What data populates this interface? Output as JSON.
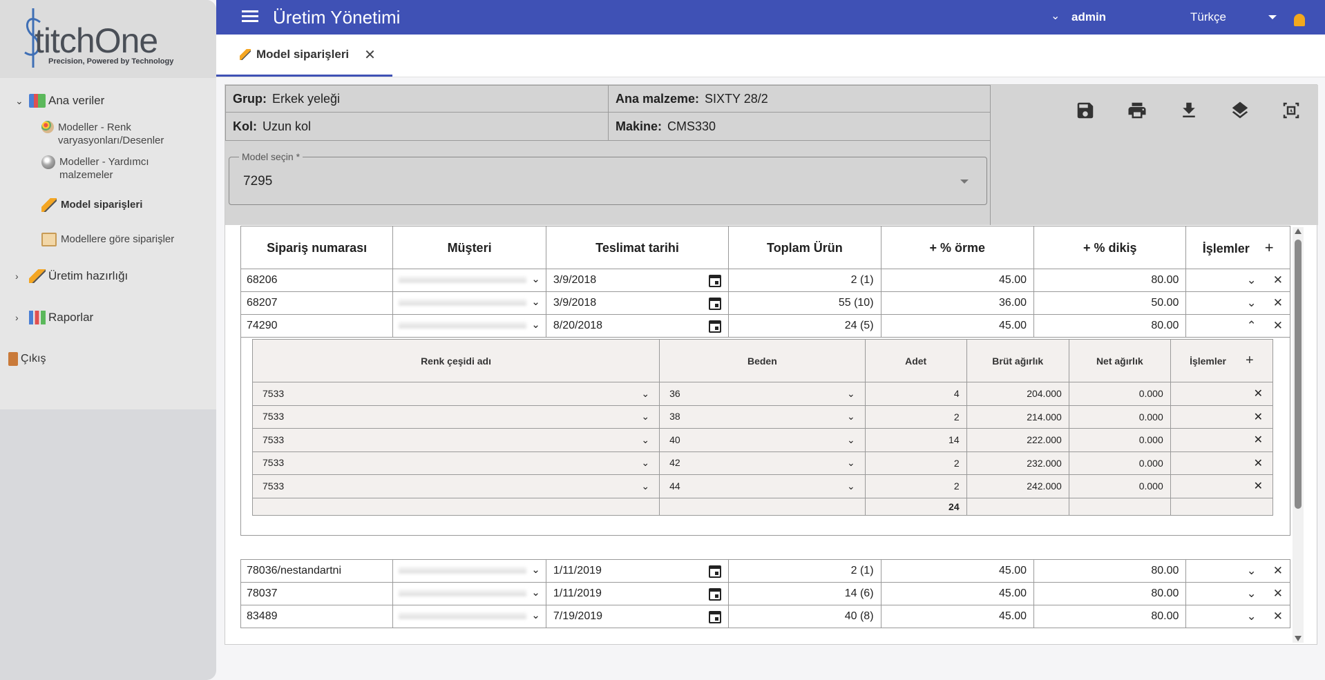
{
  "brand": {
    "logo_first": "S",
    "logo_rest": "titchOne",
    "tagline": "Precision, Powered by Technology"
  },
  "sidebar": {
    "groups": [
      {
        "label": "Ana veriler",
        "expanded": true
      },
      {
        "label": "Üretim hazırlığı",
        "expanded": false
      },
      {
        "label": "Raporlar",
        "expanded": false
      }
    ],
    "subitems": [
      {
        "label": "Modeller - Renk varyasyonları/Desenler"
      },
      {
        "label": "Modeller - Yardımcı malzemeler"
      },
      {
        "label": "Model siparişleri",
        "active": true
      },
      {
        "label": "Modellere göre siparişler"
      }
    ],
    "logout": "Çıkış"
  },
  "topbar": {
    "title": "Üretim Yönetimi",
    "user": "admin",
    "language": "Türkçe"
  },
  "tabs": [
    {
      "label": "Model siparişleri"
    }
  ],
  "header": {
    "group_label": "Grup:",
    "group_value": "Erkek yeleği",
    "material_label": "Ana malzeme:",
    "material_value": "SIXTY 28/2",
    "sleeve_label": "Kol:",
    "sleeve_value": "Uzun kol",
    "machine_label": "Makine:",
    "machine_value": "CMS330",
    "model_select_label": "Model seçin *",
    "model_select_value": "7295"
  },
  "toolbar": {
    "icons": [
      "save-icon",
      "print-icon",
      "download-icon",
      "layers-icon",
      "text-frame-icon"
    ]
  },
  "orders": {
    "columns": [
      "Sipariş numarası",
      "Müşteri",
      "Teslimat tarihi",
      "Toplam Ürün",
      "+ % örme",
      "+ % dikiş",
      "İşlemler"
    ],
    "rows_top": [
      {
        "number": "68206",
        "date": "3/9/2018",
        "total": "2 (1)",
        "knit": "45.00",
        "sew": "80.00",
        "expanded": false
      },
      {
        "number": "68207",
        "date": "3/9/2018",
        "total": "55 (10)",
        "knit": "36.00",
        "sew": "50.00",
        "expanded": false
      },
      {
        "number": "74290",
        "date": "8/20/2018",
        "total": "24 (5)",
        "knit": "45.00",
        "sew": "80.00",
        "expanded": true
      }
    ],
    "rows_bottom": [
      {
        "number": "78036/nestandartni",
        "date": "1/11/2019",
        "total": "2 (1)",
        "knit": "45.00",
        "sew": "80.00"
      },
      {
        "number": "78037",
        "date": "1/11/2019",
        "total": "14 (6)",
        "knit": "45.00",
        "sew": "80.00"
      },
      {
        "number": "83489",
        "date": "7/19/2019",
        "total": "40 (8)",
        "knit": "45.00",
        "sew": "80.00"
      }
    ]
  },
  "details": {
    "columns": [
      "Renk çeşidi adı",
      "Beden",
      "Adet",
      "Brüt ağırlık",
      "Net ağırlık",
      "İşlemler"
    ],
    "rows": [
      {
        "color": "7533",
        "size": "36",
        "qty": "4",
        "gross": "204.000",
        "net": "0.000"
      },
      {
        "color": "7533",
        "size": "38",
        "qty": "2",
        "gross": "214.000",
        "net": "0.000"
      },
      {
        "color": "7533",
        "size": "40",
        "qty": "14",
        "gross": "222.000",
        "net": "0.000"
      },
      {
        "color": "7533",
        "size": "42",
        "qty": "2",
        "gross": "232.000",
        "net": "0.000"
      },
      {
        "color": "7533",
        "size": "44",
        "qty": "2",
        "gross": "242.000",
        "net": "0.000"
      }
    ],
    "total_qty": "24"
  }
}
